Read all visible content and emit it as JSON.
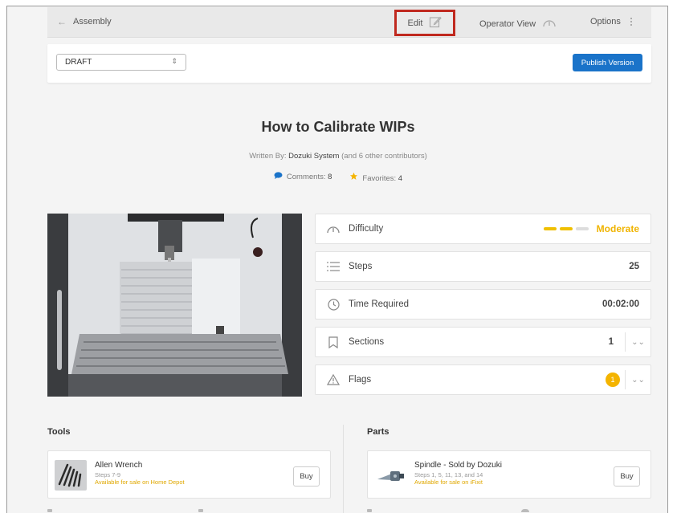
{
  "header": {
    "back_label": "Assembly",
    "edit_label": "Edit",
    "operator_view_label": "Operator View",
    "options_label": "Options"
  },
  "toolbar": {
    "version_select": "DRAFT",
    "publish_label": "Publish Version"
  },
  "guide": {
    "title": "How to Calibrate WIPs",
    "written_by_prefix": "Written By:",
    "author": "Dozuki System",
    "contributors": "(and 6 other contributors)",
    "comments_label": "Comments:",
    "comments_count": "8",
    "favorites_label": "Favorites:",
    "favorites_count": "4"
  },
  "stats": {
    "difficulty_label": "Difficulty",
    "difficulty_value": "Moderate",
    "difficulty_level": 0.67,
    "steps_label": "Steps",
    "steps_value": "25",
    "time_label": "Time Required",
    "time_value": "00:02:00",
    "sections_label": "Sections",
    "sections_value": "1",
    "flags_label": "Flags",
    "flags_value": "1"
  },
  "tools": {
    "heading": "Tools",
    "items": [
      {
        "name": "Allen Wrench",
        "steps": "Steps 7-9",
        "availability": "Available for sale on Home Depot",
        "buy_label": "Buy"
      }
    ]
  },
  "parts": {
    "heading": "Parts",
    "items": [
      {
        "name": "Spindle - Sold by Dozuki",
        "steps": "Steps 1, 5, 11, 13, and 14",
        "availability": "Available for sale on iFixit",
        "buy_label": "Buy"
      }
    ]
  },
  "colors": {
    "accent_blue": "#1a73c9",
    "edit_highlight": "#c0291f",
    "difficulty_yellow": "#f0b400",
    "badge_yellow": "#f4b400"
  }
}
